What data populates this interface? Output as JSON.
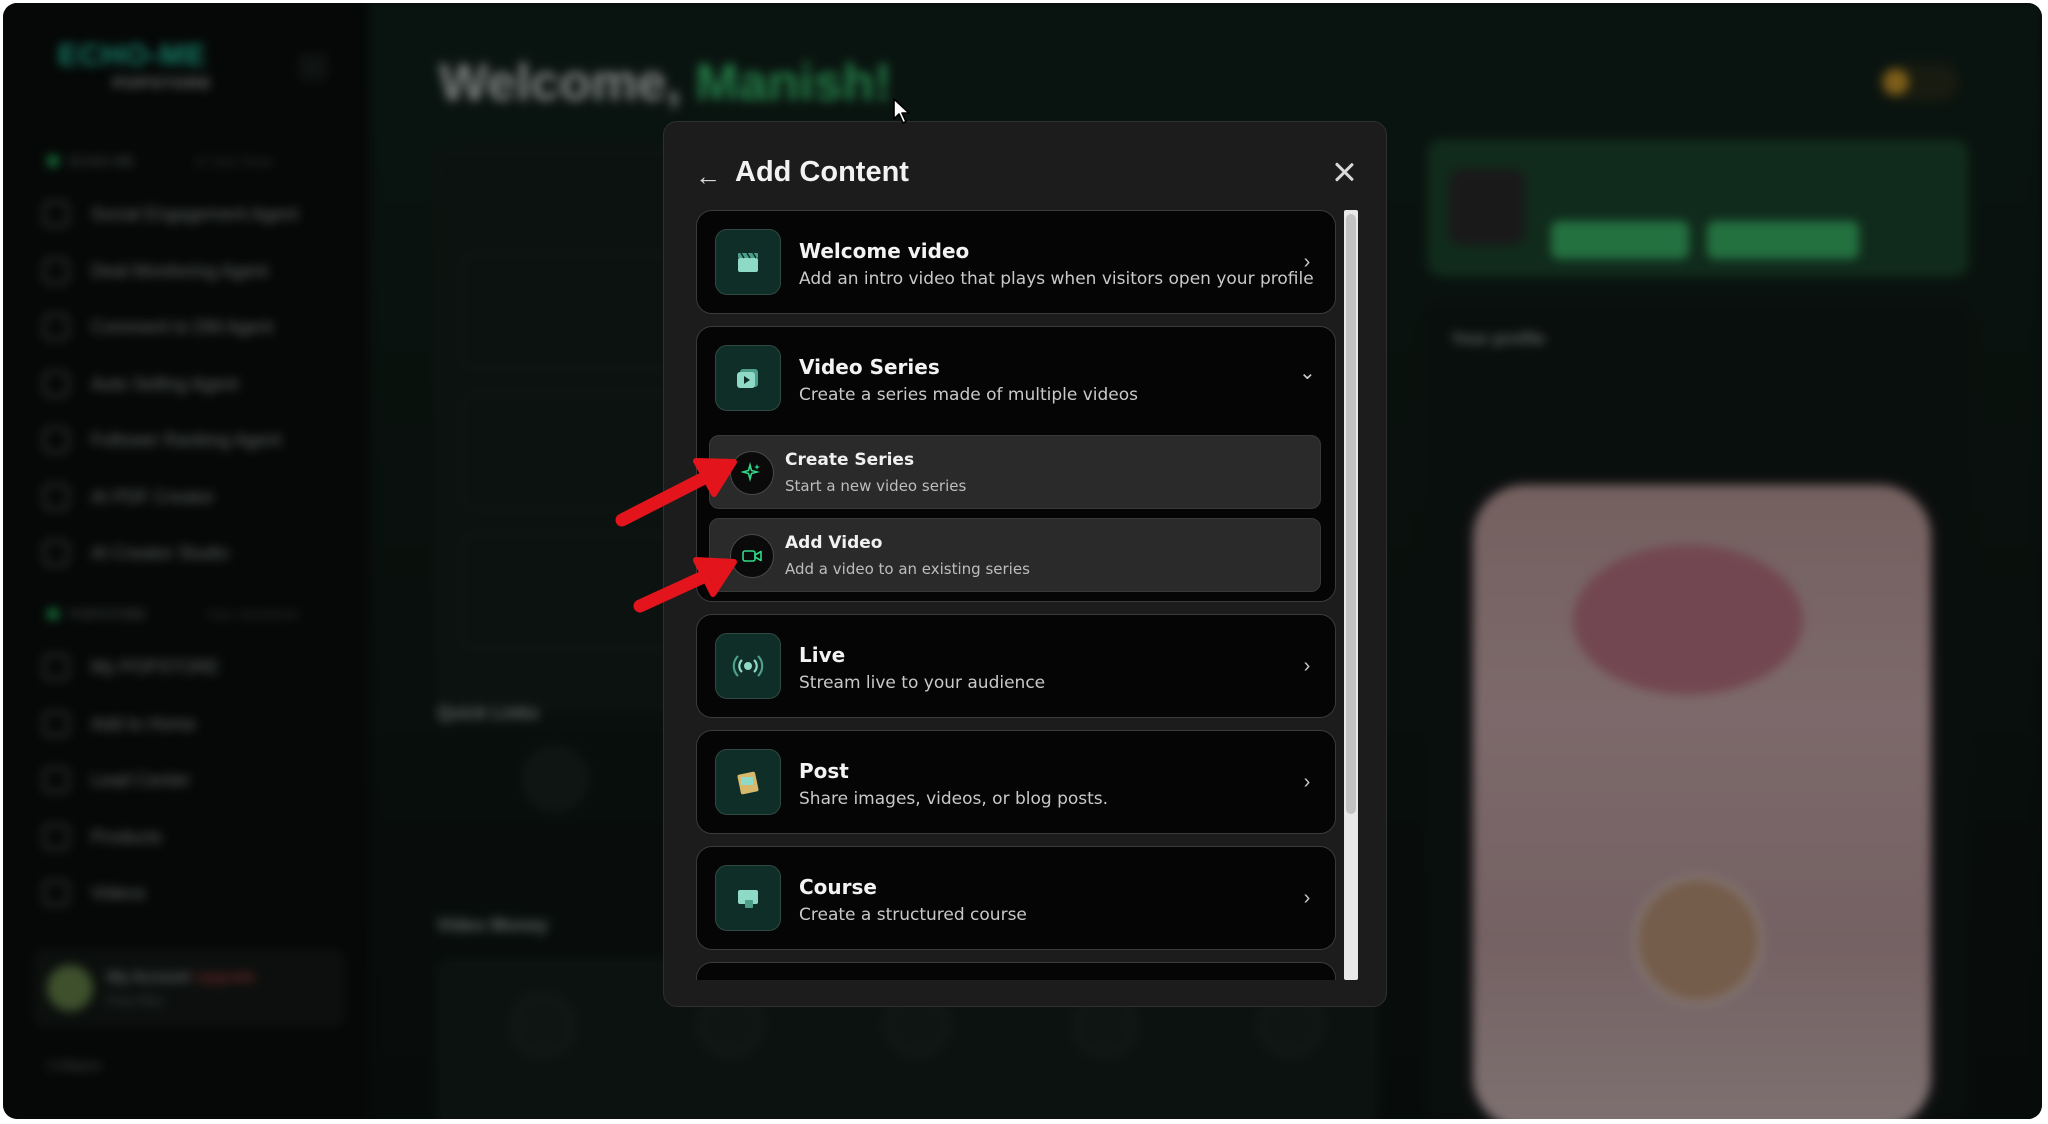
{
  "background": {
    "logo_main": "ECHO-ME",
    "logo_sub": "POPSTORE",
    "welcome_prefix": "Welcome, ",
    "welcome_name": "Manish!",
    "sidebar_group_1": "ECHO ME",
    "sidebar_group_1_hint": "AI Sub Tools",
    "sidebar_group_2": "POPSTORE",
    "sidebar_group_2_hint": "Your storefront",
    "sidebar_items_1": [
      "Social Engagement Agent",
      "Deal Monitoring Agent",
      "Comment to DM Agent",
      "Auto Selling Agent",
      "Follower Ranking Agent",
      "AI PDF Creator",
      "AI Creator Studio"
    ],
    "sidebar_items_2": [
      "My POPSTORE",
      "Add to Home",
      "Lead Center",
      "Products",
      "Videos"
    ],
    "account_name": "My Account",
    "account_badge": "Upgrade",
    "account_email": "Free Plan",
    "collapse_label": "Collapse",
    "quick_links": "Quick Links",
    "video_money": "Video Money",
    "your_profile": "Your profile"
  },
  "modal": {
    "title": "Add Content",
    "back_icon": "arrow-left-icon",
    "close_icon": "close-icon",
    "options": [
      {
        "title": "Welcome video",
        "desc": "Add an intro video that plays when visitors open your profile",
        "icon": "clapperboard-icon",
        "chevron": "›"
      },
      {
        "title": "Video Series",
        "desc": "Create a series made of multiple videos",
        "icon": "video-series-icon",
        "chevron": "⌄"
      },
      {
        "title": "Live",
        "desc": "Stream live to your audience",
        "icon": "broadcast-icon",
        "chevron": "›"
      },
      {
        "title": "Post",
        "desc": "Share images, videos, or blog posts.",
        "icon": "post-icon",
        "chevron": "›"
      },
      {
        "title": "Course",
        "desc": "Create a structured course",
        "icon": "course-icon",
        "chevron": "›"
      }
    ],
    "sub_options": [
      {
        "title": "Create Series",
        "desc": "Start a new video series",
        "icon": "sparkle-icon"
      },
      {
        "title": "Add Video",
        "desc": "Add a video to an existing series",
        "icon": "video-camera-icon"
      }
    ]
  },
  "colors": {
    "accent_green": "#30d98a",
    "arrow_red": "#e3141b",
    "modal_bg": "#1c1c1c"
  }
}
